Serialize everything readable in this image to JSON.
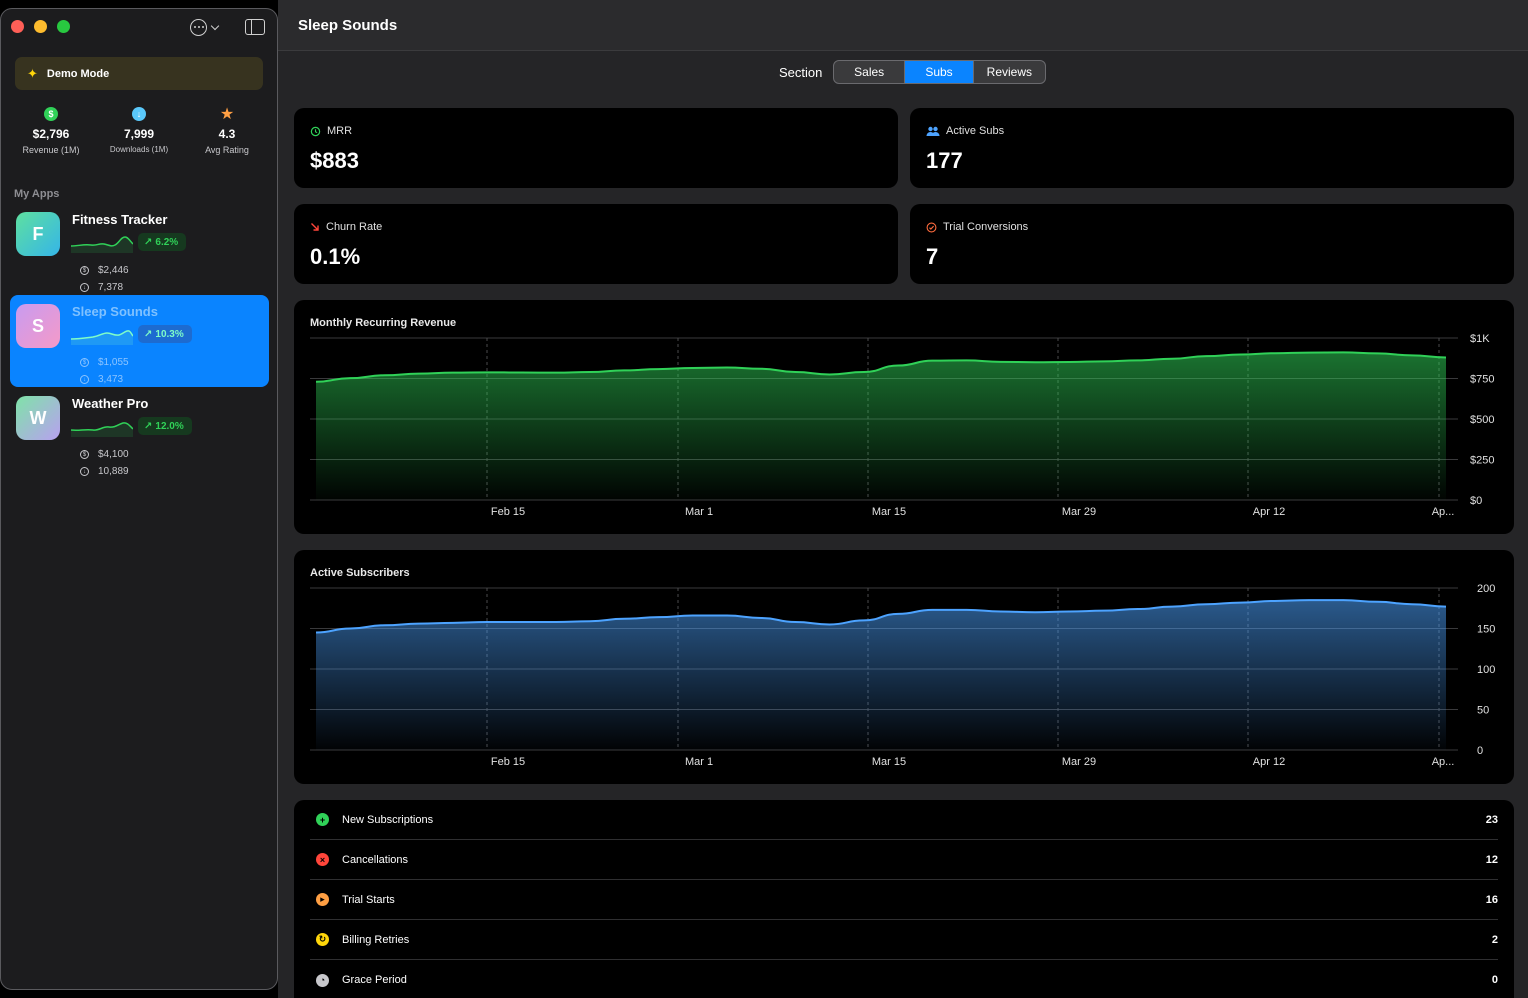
{
  "sidebar": {
    "demo_label": "Demo Mode",
    "stats": [
      {
        "value": "$2,796",
        "label": "Revenue (1M)",
        "icon": "dollar-icon",
        "color": "#30d158",
        "glyph": "$"
      },
      {
        "value": "7,999",
        "label": "Downloads (1M)",
        "icon": "download-icon",
        "color": "#5ac8fa",
        "glyph": "↓"
      },
      {
        "value": "4.3",
        "label": "Avg Rating",
        "icon": "star-icon",
        "color": "#ff9f43",
        "glyph": "★"
      }
    ],
    "section_label": "My Apps",
    "apps": [
      {
        "letter": "F",
        "name": "Fitness Tracker",
        "change": "6.2%",
        "revenue": "$2,446",
        "downloads": "7,378",
        "gradient": [
          "#5ee0a0",
          "#35b5e8"
        ]
      },
      {
        "letter": "S",
        "name": "Sleep Sounds",
        "change": "10.3%",
        "revenue": "$1,055",
        "downloads": "3,473",
        "gradient": [
          "#c89bf0",
          "#f59ac8"
        ]
      },
      {
        "letter": "W",
        "name": "Weather Pro",
        "change": "12.0%",
        "revenue": "$4,100",
        "downloads": "10,889",
        "gradient": [
          "#7fe3a8",
          "#b8a0f0"
        ]
      }
    ]
  },
  "header": {
    "title": "Sleep Sounds"
  },
  "section_picker": {
    "label": "Section",
    "options": [
      "Sales",
      "Subs",
      "Reviews"
    ],
    "selected": "Subs"
  },
  "metrics": [
    {
      "label": "MRR",
      "value": "$883",
      "icon": "mrr-icon",
      "color": "#30d158"
    },
    {
      "label": "Active Subs",
      "value": "177",
      "icon": "people-icon",
      "color": "#4da3ff"
    },
    {
      "label": "Churn Rate",
      "value": "0.1%",
      "icon": "arrow-down-right-icon",
      "color": "#ff453a"
    },
    {
      "label": "Trial Conversions",
      "value": "7",
      "icon": "checkmark-circle-icon",
      "color": "#ff6b3d"
    }
  ],
  "chart_data": [
    {
      "type": "area",
      "title": "Monthly Recurring Revenue",
      "x_ticks": [
        "Feb 15",
        "Mar 1",
        "Mar 15",
        "Mar 29",
        "Apr 12",
        "Ap..."
      ],
      "y_ticks": [
        "$0",
        "$250",
        "$500",
        "$750",
        "$1K"
      ],
      "ylim": [
        0,
        1000
      ],
      "color": "#30d158",
      "values": [
        730,
        752,
        770,
        780,
        786,
        788,
        787,
        786,
        790,
        800,
        808,
        815,
        818,
        810,
        790,
        775,
        790,
        830,
        860,
        862,
        853,
        850,
        852,
        856,
        862,
        872,
        888,
        898,
        906,
        910,
        911,
        905,
        893,
        880
      ],
      "grid": true
    },
    {
      "type": "area",
      "title": "Active Subscribers",
      "x_ticks": [
        "Feb 15",
        "Mar 1",
        "Mar 15",
        "Mar 29",
        "Apr 12",
        "Ap..."
      ],
      "y_ticks": [
        "0",
        "50",
        "100",
        "150",
        "200"
      ],
      "ylim": [
        0,
        200
      ],
      "color": "#4da3ff",
      "values": [
        145,
        150,
        154,
        156,
        157,
        158,
        158,
        158,
        159,
        162,
        164,
        166,
        166,
        163,
        158,
        155,
        160,
        168,
        173,
        173,
        171,
        170,
        171,
        172,
        174,
        177,
        180,
        182,
        184,
        185,
        185,
        183,
        180,
        177
      ],
      "grid": true
    }
  ],
  "events": [
    {
      "label": "New Subscriptions",
      "value": "23",
      "icon": "plus-circle-icon",
      "color": "#30d158",
      "glyph": "+"
    },
    {
      "label": "Cancellations",
      "value": "12",
      "icon": "x-circle-icon",
      "color": "#ff453a",
      "glyph": "×"
    },
    {
      "label": "Trial Starts",
      "value": "16",
      "icon": "play-circle-icon",
      "color": "#ff9f43",
      "glyph": "▸"
    },
    {
      "label": "Billing Retries",
      "value": "2",
      "icon": "retry-circle-icon",
      "color": "#ffd60a",
      "glyph": "↻"
    },
    {
      "label": "Grace Period",
      "value": "0",
      "icon": "clock-icon",
      "color": "#c8c8cc",
      "glyph": "◔"
    }
  ]
}
